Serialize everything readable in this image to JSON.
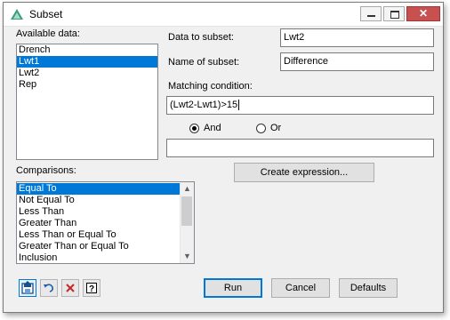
{
  "window": {
    "title": "Subset",
    "minimize_label": "Minimize",
    "maximize_label": "Maximize",
    "close_glyph": "✕"
  },
  "available": {
    "label": "Available data:",
    "items": [
      "Drench",
      "Lwt1",
      "Lwt2",
      "Rep"
    ],
    "selected_index": 1
  },
  "form": {
    "data_to_subset_label": "Data to subset:",
    "data_to_subset_value": "Lwt2",
    "name_of_subset_label": "Name of subset:",
    "name_of_subset_value": "Difference",
    "matching_condition_label": "Matching condition:",
    "matching_condition_value": "(Lwt2-Lwt1)>15",
    "and_label": "And",
    "or_label": "Or",
    "and_selected": true,
    "expression_value": "",
    "create_expression_label": "Create expression..."
  },
  "comparisons": {
    "label": "Comparisons:",
    "items": [
      "Equal To",
      "Not Equal To",
      "Less Than",
      "Greater Than",
      "Less Than or Equal To",
      "Greater Than or Equal To",
      "Inclusion"
    ],
    "selected_index": 0
  },
  "buttons": {
    "run": "Run",
    "cancel": "Cancel",
    "defaults": "Defaults"
  },
  "icons": {
    "app": "genstat-triangle-icon",
    "save_options": "save-options-icon",
    "undo": "undo-icon",
    "clear": "clear-x-icon",
    "help": "help-icon"
  },
  "colors": {
    "selection": "#0078d7",
    "clear_icon": "#c62828",
    "app_icon": "#3a9e7a"
  }
}
